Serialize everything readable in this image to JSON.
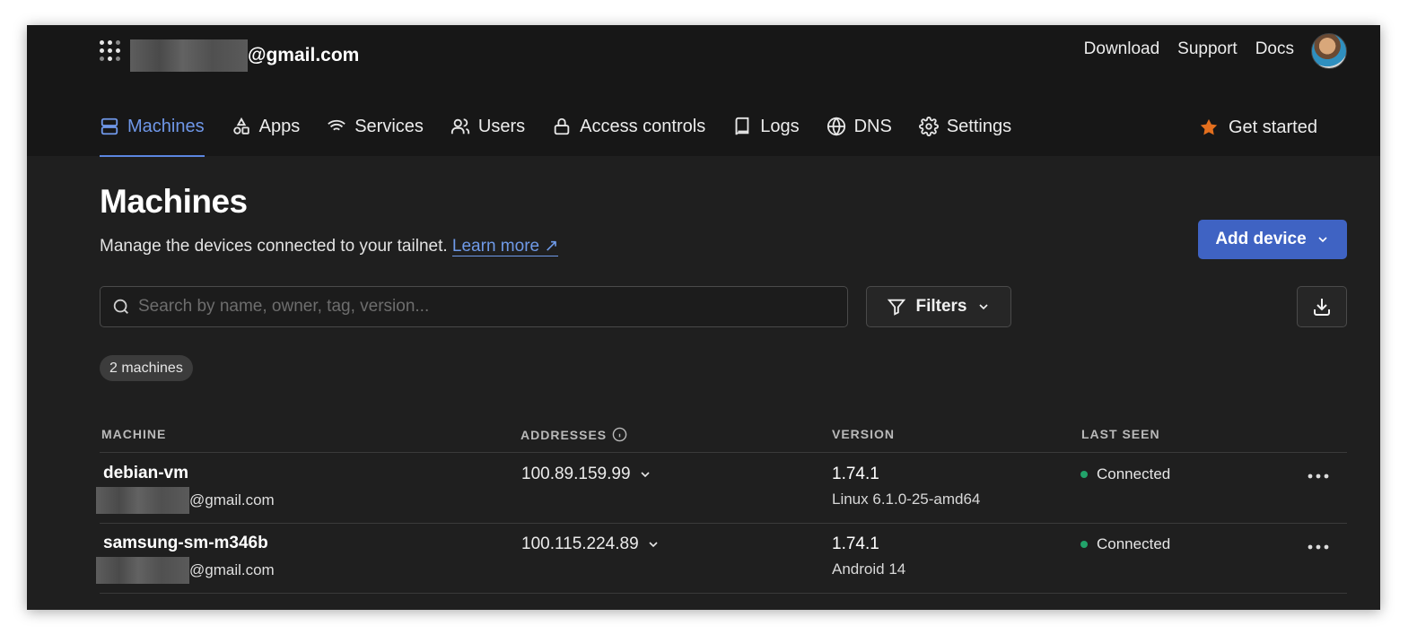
{
  "account": {
    "email_suffix": "@gmail.com"
  },
  "top_links": [
    "Download",
    "Support",
    "Docs"
  ],
  "nav": {
    "items": [
      {
        "label": "Machines",
        "icon": "server-icon",
        "active": true
      },
      {
        "label": "Apps",
        "icon": "shapes-icon"
      },
      {
        "label": "Services",
        "icon": "wifi-icon"
      },
      {
        "label": "Users",
        "icon": "users-icon"
      },
      {
        "label": "Access controls",
        "icon": "lock-icon"
      },
      {
        "label": "Logs",
        "icon": "book-icon"
      },
      {
        "label": "DNS",
        "icon": "globe-icon"
      },
      {
        "label": "Settings",
        "icon": "gear-icon"
      }
    ],
    "get_started": "Get started"
  },
  "page": {
    "title": "Machines",
    "subtitle": "Manage the devices connected to your tailnet.",
    "learn_more": "Learn more ↗",
    "add_device": "Add device"
  },
  "search": {
    "placeholder": "Search by name, owner, tag, version..."
  },
  "filters": {
    "label": "Filters"
  },
  "count_badge": "2 machines",
  "table": {
    "headers": {
      "machine": "MACHINE",
      "addresses": "ADDRESSES",
      "version": "VERSION",
      "last_seen": "LAST SEEN"
    },
    "rows": [
      {
        "name": "debian-vm",
        "owner_suffix": "@gmail.com",
        "address": "100.89.159.99",
        "version": "1.74.1",
        "os": "Linux 6.1.0-25-amd64",
        "status": "Connected"
      },
      {
        "name": "samsung-sm-m346b",
        "owner_suffix": "@gmail.com",
        "address": "100.115.224.89",
        "version": "1.74.1",
        "os": "Android 14",
        "status": "Connected"
      }
    ]
  },
  "colors": {
    "accent": "#3f63c3",
    "active_tab": "#6f97e8",
    "status_connected": "#22a36a",
    "star": "#e36f1e"
  }
}
